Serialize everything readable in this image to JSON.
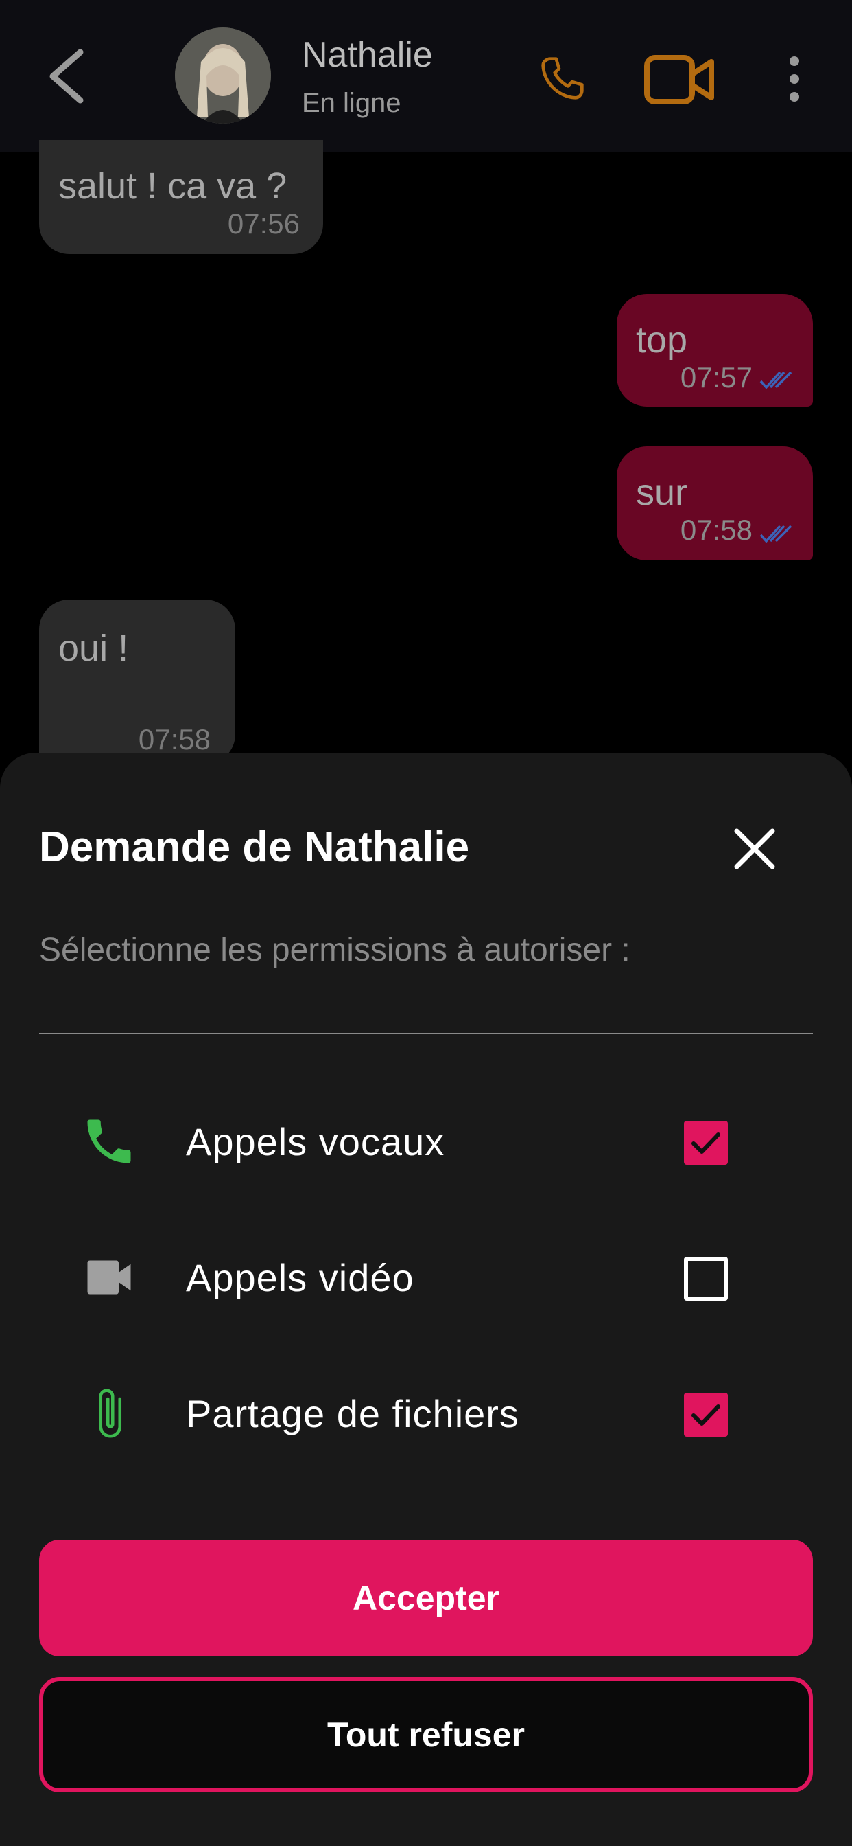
{
  "header": {
    "contact_name": "Nathalie",
    "status": "En ligne",
    "icons": {
      "back": "back-chevron-icon",
      "call": "phone-icon",
      "video": "video-camera-icon",
      "more": "more-vertical-icon"
    },
    "accent_color": "#b36b10"
  },
  "messages": [
    {
      "direction": "incoming",
      "text": "salut ! ca va ?",
      "time": "07:56"
    },
    {
      "direction": "outgoing",
      "text": "top",
      "time": "07:57",
      "read": true
    },
    {
      "direction": "outgoing",
      "text": "sur",
      "time": "07:58",
      "read": true
    },
    {
      "direction": "incoming",
      "text": "oui !",
      "time": "07:58"
    }
  ],
  "sheet": {
    "title": "Demande de Nathalie",
    "subtitle": "Sélectionne les permissions à autoriser :",
    "permissions": [
      {
        "label": "Appels vocaux",
        "icon": "phone-icon",
        "checked": true
      },
      {
        "label": "Appels vidéo",
        "icon": "video-camera-icon",
        "checked": false
      },
      {
        "label": "Partage de fichiers",
        "icon": "paperclip-icon",
        "checked": true
      }
    ],
    "accept_label": "Accepter",
    "refuse_label": "Tout refuser"
  },
  "colors": {
    "primary": "#e0155e",
    "outgoing_bubble": "#690624",
    "incoming_bubble": "#2a2a2a",
    "sheet_background": "#191919",
    "green_icon": "#3dba4e",
    "read_ticks": "#3b63b8"
  }
}
